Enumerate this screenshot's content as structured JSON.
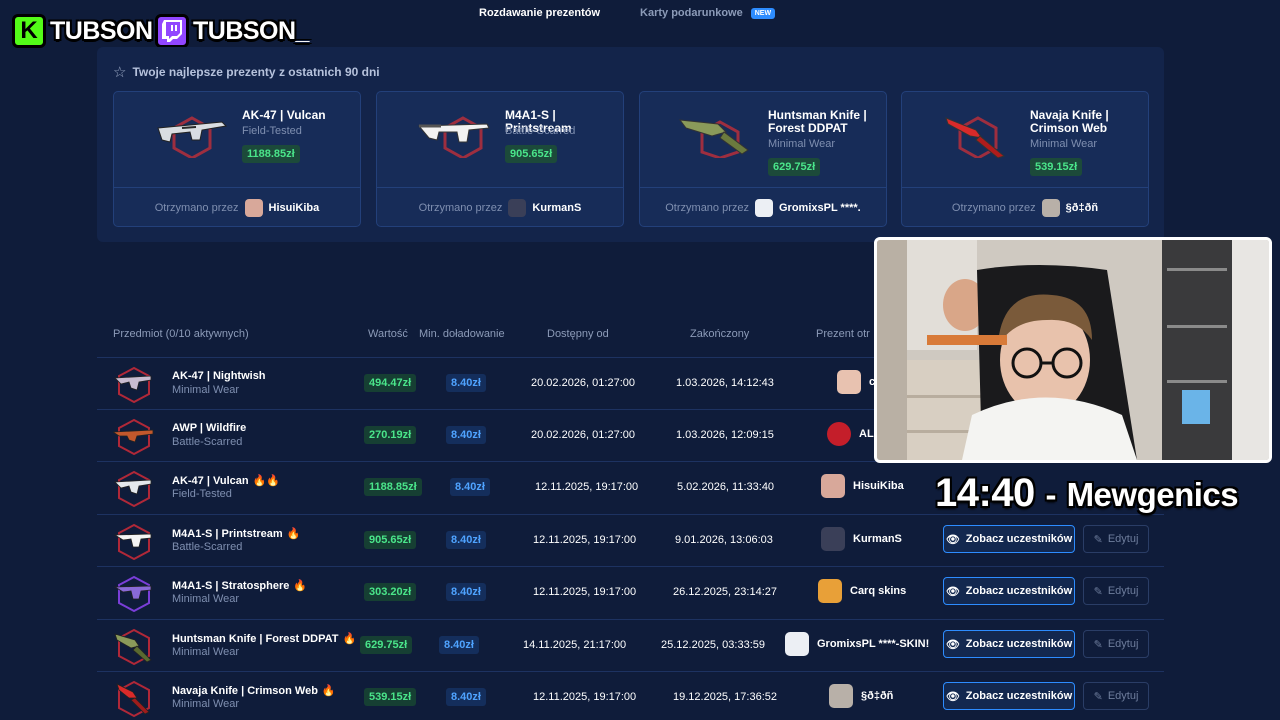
{
  "streamer": {
    "kick_name": "TUBSON",
    "twitch_name": "TUBSON_"
  },
  "tabs": [
    {
      "label": "Rozdawanie prezentów",
      "active": true
    },
    {
      "label": "Karty podarunkowe",
      "active": false,
      "badge": "NEW"
    }
  ],
  "best_gifts": {
    "title": "Twoje najlepsze prezenty z ostatnich 90 dni",
    "received_label": "Otrzymano przez",
    "items": [
      {
        "name": "AK-47 | Vulcan",
        "condition": "Field-Tested",
        "price": "1188.85zł",
        "user": "HisuiKiba"
      },
      {
        "name": "M4A1-S | Printstream",
        "condition": "Battle-Scarred",
        "price": "905.65zł",
        "user": "KurmanS"
      },
      {
        "name": "Huntsman Knife | Forest DDPAT",
        "condition": "Minimal Wear",
        "price": "629.75zł",
        "user": "GromixsPL ****."
      },
      {
        "name": "Navaja Knife | Crimson Web",
        "condition": "Minimal Wear",
        "price": "539.15zł",
        "user": "§ð‡ðñ"
      }
    ]
  },
  "table": {
    "headers": {
      "item": "Przedmiot (0/10 aktywnych)",
      "value": "Wartość",
      "min_deposit": "Min. doładowanie",
      "available_from": "Dostępny od",
      "ended": "Zakończony",
      "gift_recipient": "Prezent otr"
    },
    "view_label": "Zobacz uczestników",
    "edit_label": "Edytuj",
    "rows": [
      {
        "name": "AK-47 | Nightwish",
        "condition": "Minimal Wear",
        "flames": "",
        "value": "494.47zł",
        "min_deposit": "8.40zł",
        "available_from": "20.02.2026, 01:27:00",
        "ended": "1.03.2026, 14:12:43",
        "winner": "c"
      },
      {
        "name": "AWP | Wildfire",
        "condition": "Battle-Scarred",
        "flames": "",
        "value": "270.19zł",
        "min_deposit": "8.40zł",
        "available_from": "20.02.2026, 01:27:00",
        "ended": "1.03.2026, 12:09:15",
        "winner": "AL"
      },
      {
        "name": "AK-47 | Vulcan",
        "condition": "Field-Tested",
        "flames": "🔥🔥",
        "value": "1188.85zł",
        "min_deposit": "8.40zł",
        "available_from": "12.11.2025, 19:17:00",
        "ended": "5.02.2026, 11:33:40",
        "winner": "HisuiKiba"
      },
      {
        "name": "M4A1-S | Printstream",
        "condition": "Battle-Scarred",
        "flames": "🔥",
        "value": "905.65zł",
        "min_deposit": "8.40zł",
        "available_from": "12.11.2025, 19:17:00",
        "ended": "9.01.2026, 13:06:03",
        "winner": "KurmanS"
      },
      {
        "name": "M4A1-S | Stratosphere",
        "condition": "Minimal Wear",
        "flames": "🔥",
        "value": "303.20zł",
        "min_deposit": "8.40zł",
        "available_from": "12.11.2025, 19:17:00",
        "ended": "26.12.2025, 23:14:27",
        "winner": "Carq skins"
      },
      {
        "name": "Huntsman Knife | Forest DDPAT",
        "condition": "Minimal Wear",
        "flames": "🔥",
        "value": "629.75zł",
        "min_deposit": "8.40zł",
        "available_from": "14.11.2025, 21:17:00",
        "ended": "25.12.2025, 03:33:59",
        "winner": "GromixsPL ****-SKIN!"
      },
      {
        "name": "Navaja Knife | Crimson Web",
        "condition": "Minimal Wear",
        "flames": "🔥",
        "value": "539.15zł",
        "min_deposit": "8.40zł",
        "available_from": "12.11.2025, 19:17:00",
        "ended": "19.12.2025, 17:36:52",
        "winner": "§ð‡ðñ"
      }
    ]
  },
  "overlay": {
    "time": "14:40",
    "separator": "-",
    "game": "Mewgenics"
  },
  "colors": {
    "background": "#0f1c3a",
    "price_green": "#4ae58a",
    "accent_blue": "#2d8cff",
    "kick_green": "#53fc18",
    "twitch_purple": "#9146ff"
  }
}
